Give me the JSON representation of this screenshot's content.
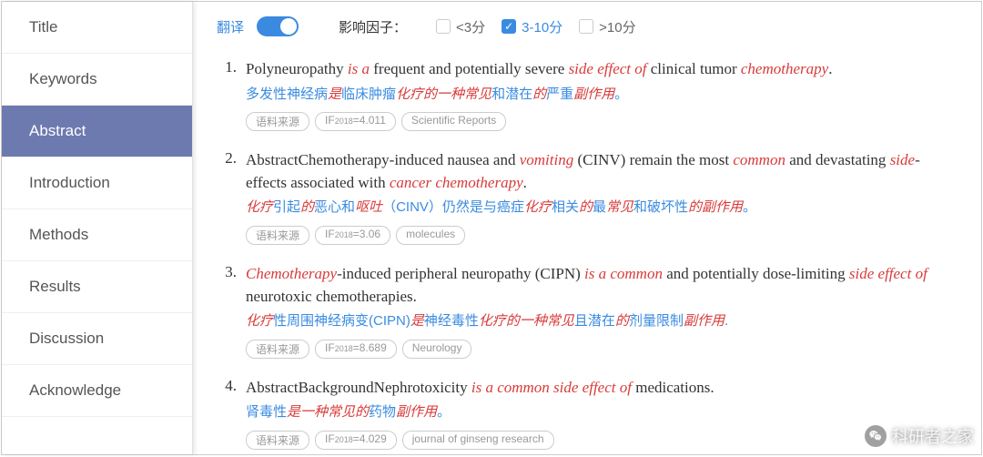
{
  "sidebar": {
    "items": [
      {
        "label": "Title"
      },
      {
        "label": "Keywords"
      },
      {
        "label": "Abstract",
        "active": true
      },
      {
        "label": "Introduction"
      },
      {
        "label": "Methods"
      },
      {
        "label": "Results"
      },
      {
        "label": "Discussion"
      },
      {
        "label": "Acknowledge"
      }
    ]
  },
  "toolbar": {
    "translate_label": "翻译",
    "translate_on": true,
    "impact_factor_label": "影响因子：",
    "filters": [
      {
        "label": "<3分",
        "checked": false
      },
      {
        "label": "3-10分",
        "checked": true
      },
      {
        "label": ">10分",
        "checked": false
      }
    ]
  },
  "tag_labels": {
    "source": "语料来源"
  },
  "entries": [
    {
      "num": "1.",
      "en_parts": [
        {
          "t": "Polyneuropathy "
        },
        {
          "t": "is a",
          "hl": true
        },
        {
          "t": " frequent and potentially severe "
        },
        {
          "t": "side effect of",
          "hl": true
        },
        {
          "t": " clinical tumor "
        },
        {
          "t": "chemotherapy",
          "hl": true
        },
        {
          "t": "."
        }
      ],
      "zh_parts": [
        {
          "t": "多发性神经病"
        },
        {
          "t": "是",
          "hl": true
        },
        {
          "t": "临床肿瘤"
        },
        {
          "t": "化疗的一种常见",
          "hl": true
        },
        {
          "t": "和潜在"
        },
        {
          "t": "的",
          "hl": true
        },
        {
          "t": "严重"
        },
        {
          "t": "副作用",
          "hl": true
        },
        {
          "t": "。"
        }
      ],
      "if_year": "2018",
      "if_value": "4.011",
      "journal": "Scientific Reports"
    },
    {
      "num": "2.",
      "en_parts": [
        {
          "t": "AbstractChemotherapy-induced nausea and "
        },
        {
          "t": "vomiting",
          "hl": true
        },
        {
          "t": " (CINV) remain the most "
        },
        {
          "t": "common",
          "hl": true
        },
        {
          "t": " and devastating "
        },
        {
          "t": "side",
          "hl": true
        },
        {
          "t": "-effects associated with "
        },
        {
          "t": "cancer chemotherapy",
          "hl": true
        },
        {
          "t": "."
        }
      ],
      "zh_parts": [
        {
          "t": "化疗",
          "hl": true
        },
        {
          "t": "引起"
        },
        {
          "t": "的",
          "hl": true
        },
        {
          "t": "恶心和"
        },
        {
          "t": "呕吐",
          "hl": true
        },
        {
          "t": "（CINV）仍然是与癌症"
        },
        {
          "t": "化疗",
          "hl": true
        },
        {
          "t": "相关"
        },
        {
          "t": "的",
          "hl": true
        },
        {
          "t": "最"
        },
        {
          "t": "常见",
          "hl": true
        },
        {
          "t": "和破坏性"
        },
        {
          "t": "的副作用",
          "hl": true
        },
        {
          "t": "。"
        }
      ],
      "if_year": "2018",
      "if_value": "3.06",
      "journal": "molecules"
    },
    {
      "num": "3.",
      "en_parts": [
        {
          "t": "Chemotherapy",
          "hl": true
        },
        {
          "t": "-induced peripheral neuropathy (CIPN) "
        },
        {
          "t": "is a common",
          "hl": true
        },
        {
          "t": " and potentially dose-limiting "
        },
        {
          "t": "side effect of",
          "hl": true
        },
        {
          "t": " neurotoxic chemotherapies."
        }
      ],
      "zh_parts": [
        {
          "t": "化疗",
          "hl": true
        },
        {
          "t": "性周围神经病变(CIPN)"
        },
        {
          "t": "是",
          "hl": true
        },
        {
          "t": "神经毒性"
        },
        {
          "t": "化疗的一种常见",
          "hl": true
        },
        {
          "t": "且潜在"
        },
        {
          "t": "的",
          "hl": true
        },
        {
          "t": "剂量限制"
        },
        {
          "t": "副作用",
          "hl": true
        },
        {
          "t": "."
        }
      ],
      "if_year": "2018",
      "if_value": "8.689",
      "journal": "Neurology"
    },
    {
      "num": "4.",
      "en_parts": [
        {
          "t": "AbstractBackgroundNephrotoxicity "
        },
        {
          "t": "is a common side effect of",
          "hl": true
        },
        {
          "t": " medications."
        }
      ],
      "zh_parts": [
        {
          "t": "肾毒性"
        },
        {
          "t": "是一种常见的",
          "hl": true
        },
        {
          "t": "药物"
        },
        {
          "t": "副作用",
          "hl": true
        },
        {
          "t": "。"
        }
      ],
      "if_year": "2018",
      "if_value": "4.029",
      "journal": "journal of ginseng research"
    }
  ],
  "watermark": {
    "text": "科研者之家"
  }
}
